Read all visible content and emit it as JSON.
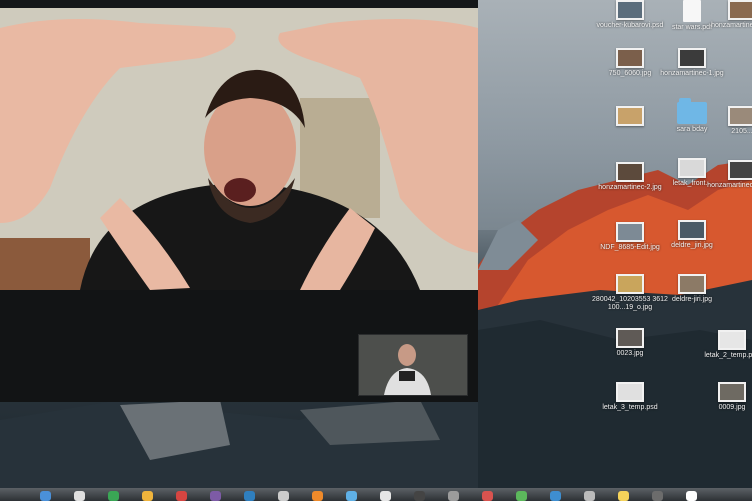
{
  "desktop": {
    "files": [
      {
        "name": "voucher-kubarovi.psd",
        "kind": "image",
        "thumb": "#5b6d7c"
      },
      {
        "name": "star wars.pdf",
        "kind": "doc",
        "thumb": "#f7f7f7"
      },
      {
        "name": "honzamartinec-66...",
        "kind": "image",
        "thumb": "#8a6a50"
      },
      {
        "name": "750_6060.jpg",
        "kind": "image",
        "thumb": "#7b5f4b"
      },
      {
        "name": "honzamartinec-1.jpg",
        "kind": "image",
        "thumb": "#3b3b3b"
      },
      {
        "name": "",
        "kind": "image",
        "thumb": "#c8a26a"
      },
      {
        "name": "sara bday",
        "kind": "folder",
        "thumb": "#6fb7e6"
      },
      {
        "name": "2105...",
        "kind": "image",
        "thumb": "#9a8a7a"
      },
      {
        "name": "honzamartinec-2.jpg",
        "kind": "image",
        "thumb": "#5c4a3c"
      },
      {
        "name": "letak_front...",
        "kind": "image",
        "thumb": "#d9d9d9"
      },
      {
        "name": "honzamartinec-1-2.jpg",
        "kind": "image",
        "thumb": "#434343"
      },
      {
        "name": "NDF_8685-Edit.jpg",
        "kind": "image",
        "thumb": "#7d8a95"
      },
      {
        "name": "deldre_jiri.jpg",
        "kind": "image",
        "thumb": "#4a5a66"
      },
      {
        "name": "280042_10203553 3612100...19_o.jpg",
        "kind": "image",
        "thumb": "#c9a55c"
      },
      {
        "name": "deldre-jiri.jpg",
        "kind": "image",
        "thumb": "#8c7a66"
      },
      {
        "name": "0023.jpg",
        "kind": "image",
        "thumb": "#5f5a56"
      },
      {
        "name": "letak_2_temp.psd",
        "kind": "image",
        "thumb": "#e6e6e6"
      },
      {
        "name": "letak_3_temp.psd",
        "kind": "image",
        "thumb": "#e0e0e0"
      },
      {
        "name": "0009.jpg",
        "kind": "image",
        "thumb": "#6e6a62"
      }
    ]
  },
  "dock": {
    "apps": [
      "#4a90d9",
      "#e0e0e0",
      "#3aa655",
      "#f0b43c",
      "#d64541",
      "#7d5ba6",
      "#2f7fbf",
      "#cccccc",
      "#ef8a2a",
      "#5fb0e6",
      "#e6e6e6",
      "#444444",
      "#9c9c9c",
      "#d9534f",
      "#5cb85c",
      "#3e8ed0",
      "#bbbbbb",
      "#f5d35a",
      "#6c6c6c",
      "#ffffff"
    ]
  }
}
